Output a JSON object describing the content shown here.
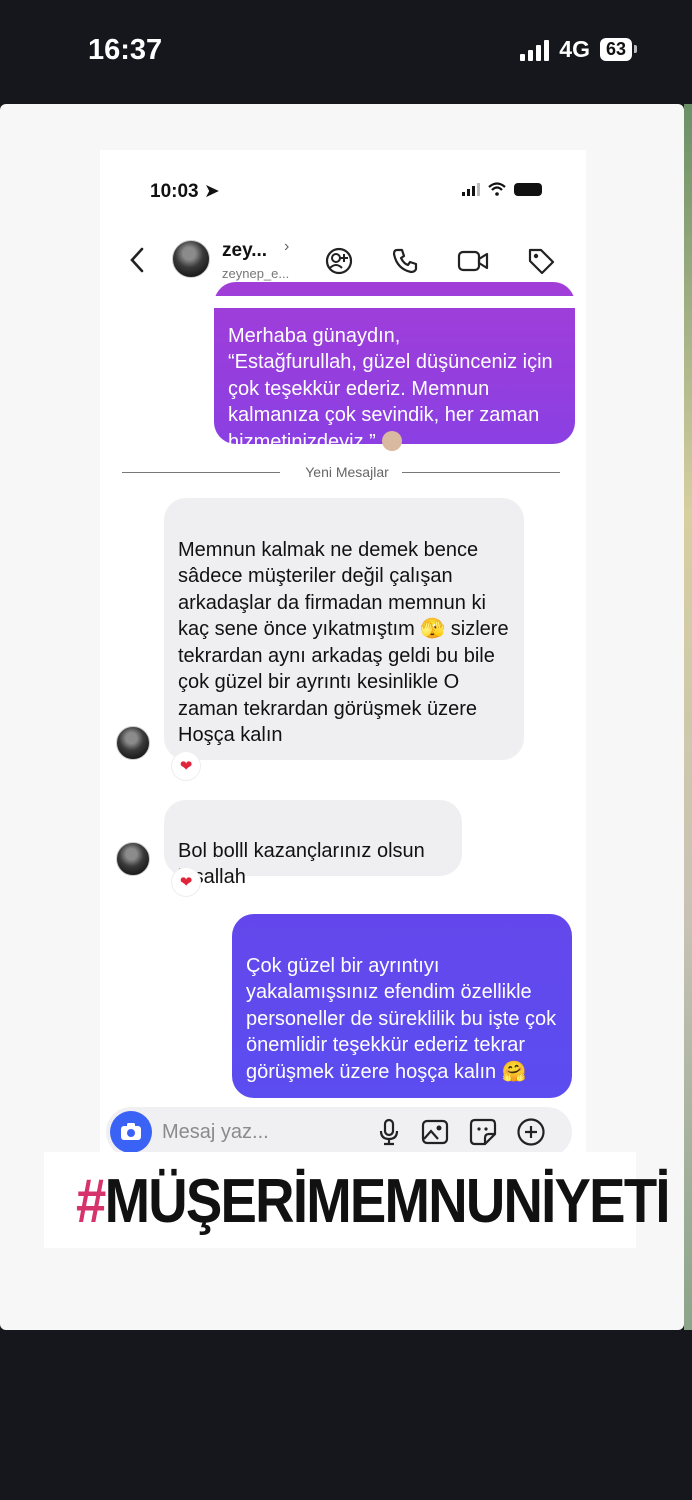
{
  "status_bar": {
    "time": "16:37",
    "network": "4G",
    "battery": "63"
  },
  "inner_status": {
    "time": "10:03"
  },
  "chat_header": {
    "name": "zey...",
    "username": "zeynep_e..."
  },
  "divider_label": "Yeni Mesajlar",
  "messages": [
    {
      "direction": "outgoing",
      "text": "Merhaba günaydın,\n“Estağfurullah, güzel düşünceniz için çok teşekkür ederiz. Memnun kalmanıza çok sevindik, her zaman hizmetinizdeyiz.”"
    },
    {
      "direction": "incoming",
      "text": "Memnun kalmak ne demek bence sâdece müşteriler değil çalışan arkadaşlar da firmadan memnun ki kaç sene önce yıkatmıştım 🫣 sizlere  tekrardan aynı arkadaş geldi bu bile çok güzel bir ayrıntı  kesinlikle O zaman tekrardan görüşmek üzere Hoşça kalın",
      "reaction": "❤"
    },
    {
      "direction": "incoming",
      "text": "Bol bolll kazançlarınız olsun inşallah",
      "reaction": "❤"
    },
    {
      "direction": "outgoing",
      "text": "Çok güzel bir ayrıntıyı yakalamışsınız efendim özellikle personeller de süreklilik bu işte çok önemlidir teşekkür ederiz tekrar görüşmek üzere hoşça kalın 🤗"
    }
  ],
  "composer": {
    "placeholder": "Mesaj yaz..."
  },
  "hashtag": {
    "symbol": "#",
    "text": "MÜŞERİMEMNUNİYETİ"
  },
  "colors": {
    "outgoing_top": "#9b3fd9",
    "outgoing_bottom": "#5b4df0",
    "camera_button": "#3a62f5",
    "hashtag_symbol": "#d6336c"
  }
}
